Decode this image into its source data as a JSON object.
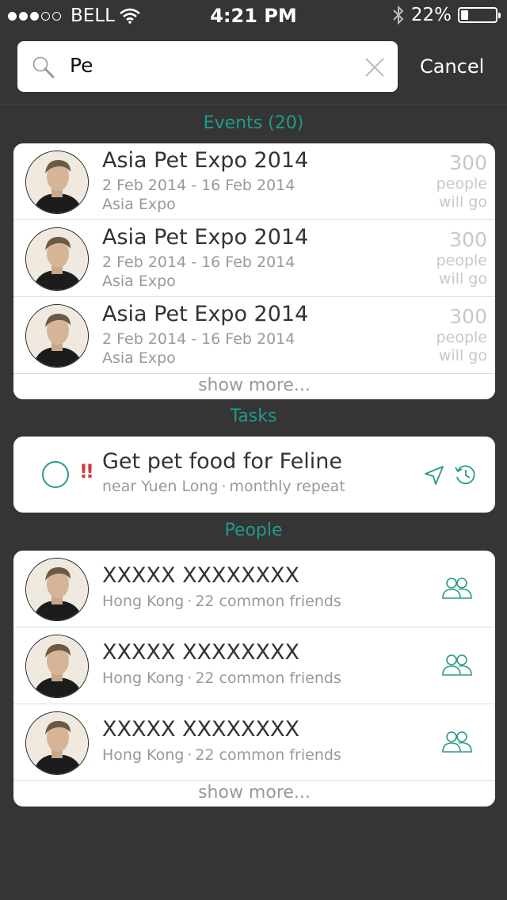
{
  "status_bar": {
    "carrier": "BELL",
    "signal_filled": 3,
    "signal_total": 5,
    "time": "4:21 PM",
    "battery": "22%",
    "battery_level": 0.22
  },
  "search": {
    "query": "Pe",
    "cancel_label": "Cancel"
  },
  "events": {
    "heading": "Events (20)",
    "items": [
      {
        "title": "Asia Pet Expo 2014",
        "dates": "2 Feb 2014 - 16 Feb 2014",
        "venue": "Asia Expo",
        "count": "300",
        "line1": "people",
        "line2": "will go"
      },
      {
        "title": "Asia Pet Expo 2014",
        "dates": "2 Feb 2014 - 16 Feb 2014",
        "venue": "Asia Expo",
        "count": "300",
        "line1": "people",
        "line2": "will go"
      },
      {
        "title": "Asia Pet Expo 2014",
        "dates": "2 Feb 2014 - 16 Feb 2014",
        "venue": "Asia Expo",
        "count": "300",
        "line1": "people",
        "line2": "will go"
      }
    ],
    "show_more": "show more..."
  },
  "tasks": {
    "heading": "Tasks",
    "items": [
      {
        "priority": "!!",
        "title": "Get pet food for Feline",
        "location": "near Yuen Long",
        "repeat": "monthly repeat"
      }
    ]
  },
  "people": {
    "heading": "People",
    "separator": "·",
    "items": [
      {
        "name": "XXXXX XXXXXXXX",
        "location": "Hong Kong",
        "common": "22 common friends"
      },
      {
        "name": "XXXXX XXXXXXXX",
        "location": "Hong Kong",
        "common": "22 common friends"
      },
      {
        "name": "XXXXX XXXXXXXX",
        "location": "Hong Kong",
        "common": "22 common friends"
      }
    ],
    "show_more": "show more..."
  },
  "colors": {
    "accent": "#1e9b8a",
    "background": "#353535",
    "priority": "#d23b3b"
  }
}
